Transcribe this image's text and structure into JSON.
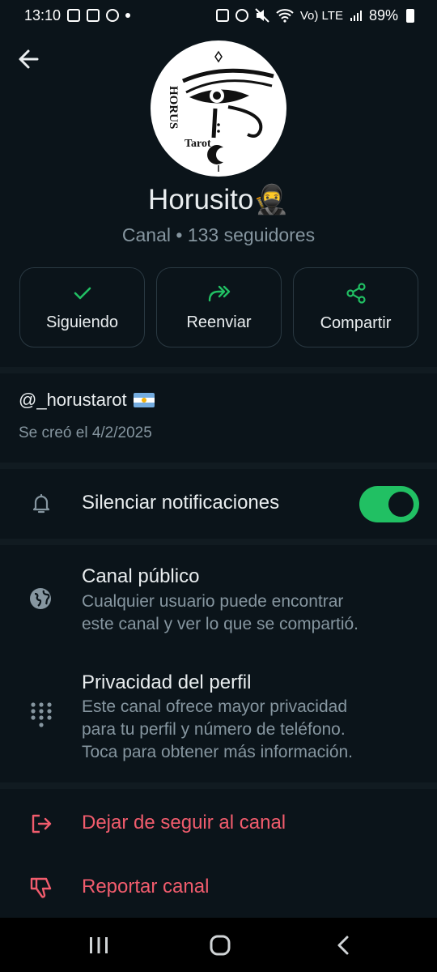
{
  "status_bar": {
    "time": "13:10",
    "network": "Vo) LTE",
    "battery": "89%"
  },
  "channel": {
    "name": "Horusito🥷",
    "subtitle": "Canal • 133 seguidores",
    "avatar": {
      "side_text": "HORUS",
      "bottom_text": "Tarot"
    }
  },
  "actions": [
    {
      "label": "Siguiendo",
      "icon": "check-icon"
    },
    {
      "label": "Reenviar",
      "icon": "forward-icon"
    },
    {
      "label": "Compartir",
      "icon": "share-icon"
    }
  ],
  "about": {
    "handle": "@_horustarot",
    "created": "Se creó el 4/2/2025"
  },
  "settings": {
    "mute": {
      "label": "Silenciar notificaciones",
      "enabled": true
    },
    "public": {
      "title": "Canal público",
      "desc_line1": "Cualquier usuario puede encontrar",
      "desc_line2": "este canal y ver lo que se compartió."
    },
    "privacy": {
      "title": "Privacidad del perfil",
      "desc_line1": "Este canal ofrece mayor privacidad",
      "desc_line2": "para tu perfil y número de teléfono.",
      "desc_line3": "Toca para obtener más información."
    }
  },
  "danger_actions": {
    "unfollow": "Dejar de seguir al canal",
    "report": "Reportar canal"
  },
  "colors": {
    "background": "#0b141a",
    "accent": "#21c063",
    "danger": "#f15c6d",
    "muted_text": "#8696a0"
  }
}
